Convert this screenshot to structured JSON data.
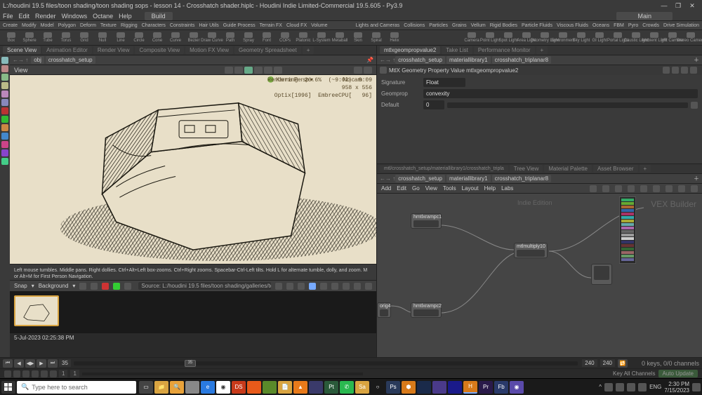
{
  "window": {
    "title": "L:/houdini 19.5 files/toon shading/toon shading sops - lesson 14 - Crosshatch shader.hiplc - Houdini Indie Limited-Commercial 19.5.605 - Py3.9"
  },
  "menus": [
    "File",
    "Edit",
    "Render",
    "Windows",
    "Octane",
    "Help"
  ],
  "build_dropdown": "Build",
  "main_dropdown": "Main",
  "shelfTabs": [
    "Create",
    "Modify",
    "Model",
    "Polygon",
    "Deform",
    "Texture",
    "Rigging",
    "Characters",
    "Constraints",
    "Hair Utils",
    "Guide Process",
    "Terrain FX",
    "Cloud FX",
    "Volume"
  ],
  "shelfTabs2": [
    "Lights and Cameras",
    "Collisions",
    "Particles",
    "Grains",
    "Vellum",
    "Rigid Bodies",
    "Particle Fluids",
    "Viscous Fluids",
    "Oceans",
    "FBM",
    "Pyro",
    "Crowds",
    "Drive Simulation"
  ],
  "shelfTools": [
    "Box",
    "Sphere",
    "Tube",
    "Torus",
    "Grid",
    "Null",
    "Line",
    "Circle",
    "Cone",
    "Curve",
    "Bezier",
    "Draw Curve",
    "Path",
    "Spray",
    "Font",
    "COPs",
    "Platonic",
    "L-System",
    "Metaball",
    "Skin",
    "Spiral",
    "Helix"
  ],
  "shelfToolsR": [
    "Camera",
    "Point Light",
    "Spot Light",
    "Area Light",
    "Geometry Light",
    "Environment",
    "Sky Light",
    "GI Light",
    "Portal Light",
    "Caustic Light",
    "Ambient Light",
    "VR Camera",
    "Stereo Camera"
  ],
  "paneTabs": [
    "Scene View",
    "Animation Editor",
    "Render View",
    "Composite View",
    "Motion FX View",
    "Geometry Spreadsheet"
  ],
  "paneTabsR": [
    "mtlxgeompropvalue2",
    "Take List",
    "Performance Monitor"
  ],
  "path": {
    "obj": "obj",
    "setup": "crosshatch_setup"
  },
  "view_title": "View",
  "vp_badge": "Karma Persp",
  "vp_nocam": "No cam",
  "vp_overlay": "Rendering  26.6%  (~9:02)  9:09\n             958 x 556\nOptix[1996]  EmbreeCPU[   96]",
  "vp_hint": "Left mouse tumbles. Middle pans. Right dollies. Ctrl+Alt+Left box-zooms. Ctrl+Right zooms. Spacebar-Ctrl-Left tilts. Hold L for alternate tumble, dolly, and zoom.    M or Alt+M for First Person Navigation.",
  "snap_label": "Snap",
  "bg_label": "Background",
  "source": "Source: L:/houdini 19.5 files/toon shading/galleries/toon s",
  "timestamp": "5-Jul-2023 02:25:38 PM",
  "paramHeader": "MtlX Geometry Property Value  mtlxgeompropvalue2",
  "param_sig": "Signature",
  "param_sig_val": "Float",
  "param_gp": "Geomprop",
  "param_gp_val": "convexity",
  "param_def": "Default",
  "param_def_val": "0",
  "nodePath": {
    "a": "crosshatch_setup",
    "b": "materiallibrary1",
    "c": "crosshatch_triplanar8"
  },
  "nodeTabsR": [
    "Tree View",
    "Material Palette",
    "Asset Browser"
  ],
  "nodeMenus": [
    "Add",
    "Edit",
    "Go",
    "View",
    "Tools",
    "Layout",
    "Help",
    "Labs"
  ],
  "watermark": "VEX Builder",
  "wm2": "Indie Edition",
  "nodes": {
    "ramp1": "hmtlxrampc1",
    "ramp2": "hmtlxrampc2",
    "mult": "mtlmultiply10",
    "out": "",
    "in4": "orig4"
  },
  "tl_cur": "35",
  "tl_end1": "240",
  "tl_end2": "240",
  "tl_keys": "0 keys, 0/0 channels",
  "tl_keyall": "Key All Channels",
  "tl_auto": "Auto Update",
  "status_f1": "1",
  "status_f2": "1",
  "taskbar": {
    "search": "Type here to search",
    "time": "2:30 PM",
    "date": "7/15/2023",
    "lang": "ENG"
  }
}
